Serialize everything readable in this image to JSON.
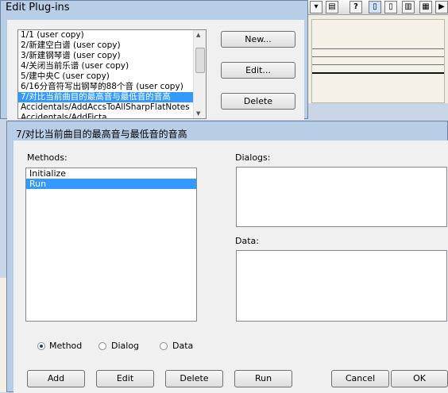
{
  "edit_plugins": {
    "title": "Edit Plug-ins",
    "plugins": [
      "1/1 (user copy)",
      "2/新建空白谱 (user copy)",
      "3/新建钢琴谱 (user copy)",
      "4/关闭当前乐谱 (user copy)",
      "5/建中央C (user copy)",
      "6/16分音符写出钢琴的88个音 (user copy)",
      "7/对比当前曲目的最高音与最低音的音高",
      "Accidentals/AddAccsToAllSharpFlatNotes",
      "Accidentals/AddFicta"
    ],
    "selected_plugin_index": 6,
    "buttons": {
      "new": "New...",
      "edit": "Edit...",
      "delete": "Delete"
    }
  },
  "plugin_editor": {
    "title": "7/对比当前曲目的最高音与最低音的音高",
    "methods_label": "Methods:",
    "methods": [
      "Initialize",
      "Run"
    ],
    "selected_method_index": 1,
    "dialogs_label": "Dialogs:",
    "data_label": "Data:",
    "radio": {
      "method": "Method",
      "dialog": "Dialog",
      "data": "Data",
      "selected": "method"
    },
    "buttons": {
      "add": "Add",
      "edit": "Edit",
      "delete": "Delete",
      "run": "Run",
      "cancel": "Cancel",
      "ok": "OK"
    }
  },
  "toolbar": {
    "help_glyph": "?",
    "play_glyph": "▶"
  }
}
